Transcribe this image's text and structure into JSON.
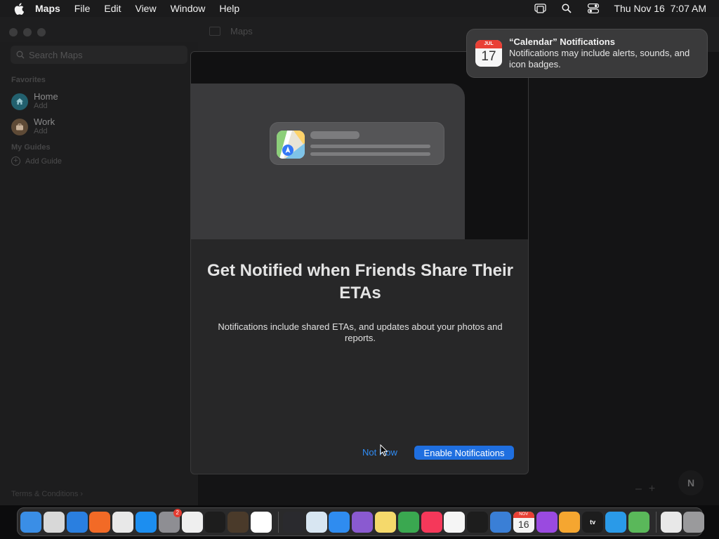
{
  "menubar": {
    "app_name": "Maps",
    "items": [
      "File",
      "Edit",
      "View",
      "Window",
      "Help"
    ],
    "datetime": "Thu Nov 16  7:07 AM"
  },
  "window": {
    "title": "Maps"
  },
  "sidebar": {
    "search_placeholder": "Search Maps",
    "favorites_header": "Favorites",
    "favorites": [
      {
        "title": "Home",
        "subtitle": "Add",
        "color": "#2d8a9e"
      },
      {
        "title": "Work",
        "subtitle": "Add",
        "color": "#8a6a4a"
      }
    ],
    "guides_header": "My Guides",
    "add_guide": "Add Guide",
    "terms": "Terms & Conditions"
  },
  "map": {
    "zoom_out": "–",
    "zoom_in": "+",
    "compass": "N"
  },
  "sheet": {
    "title": "Get Notified when Friends Share Their ETAs",
    "body": "Notifications include shared ETAs, and updates about your photos and reports.",
    "not_now": "Not Now",
    "enable": "Enable Notifications"
  },
  "banner": {
    "icon_month": "JUL",
    "icon_day": "17",
    "title": "“Calendar” Notifications",
    "text": "Notifications may include alerts, sounds, and icon badges."
  },
  "dock": {
    "items": [
      {
        "name": "finder",
        "color": "#3a8ee6"
      },
      {
        "name": "launchpad",
        "color": "#d8d8d8"
      },
      {
        "name": "safari",
        "color": "#2a7fe0"
      },
      {
        "name": "firefox",
        "color": "#f26a26"
      },
      {
        "name": "chrome",
        "color": "#e8e8e8"
      },
      {
        "name": "app-store",
        "color": "#1c8ef0"
      },
      {
        "name": "system-settings",
        "color": "#8e8e93",
        "badge": "2"
      },
      {
        "name": "textedit",
        "color": "#efefef"
      },
      {
        "name": "terminal",
        "color": "#1d1d1d"
      },
      {
        "name": "instruments",
        "color": "#4a3a2a"
      },
      {
        "name": "vscode",
        "color": "#ffffff"
      },
      {
        "name": "separator"
      },
      {
        "name": "clock-app",
        "color": "#2a2a2e"
      },
      {
        "name": "quicktime",
        "color": "#d8e6f2"
      },
      {
        "name": "mail",
        "color": "#2f8cf0"
      },
      {
        "name": "visual-studio",
        "color": "#8a5ad0"
      },
      {
        "name": "notes",
        "color": "#f5d96b"
      },
      {
        "name": "numbers",
        "color": "#3aa850"
      },
      {
        "name": "music",
        "color": "#f5385a"
      },
      {
        "name": "clock",
        "color": "#f5f5f5"
      },
      {
        "name": "voice-memos",
        "color": "#1d1d1d"
      },
      {
        "name": "preview",
        "color": "#3a7fd6"
      },
      {
        "name": "calendar",
        "month": "NOV",
        "day": "16"
      },
      {
        "name": "podcasts",
        "color": "#9a4ae0"
      },
      {
        "name": "home",
        "color": "#f5a630"
      },
      {
        "name": "apple-tv",
        "label": "tv",
        "color": "#1d1d1d"
      },
      {
        "name": "edge-canary",
        "color": "#2a9ae8"
      },
      {
        "name": "maps",
        "color": "#5ab85a"
      },
      {
        "name": "separator"
      },
      {
        "name": "documents-folder",
        "color": "#e8e8e8"
      },
      {
        "name": "trash",
        "color": "#9a9a9c"
      }
    ]
  }
}
